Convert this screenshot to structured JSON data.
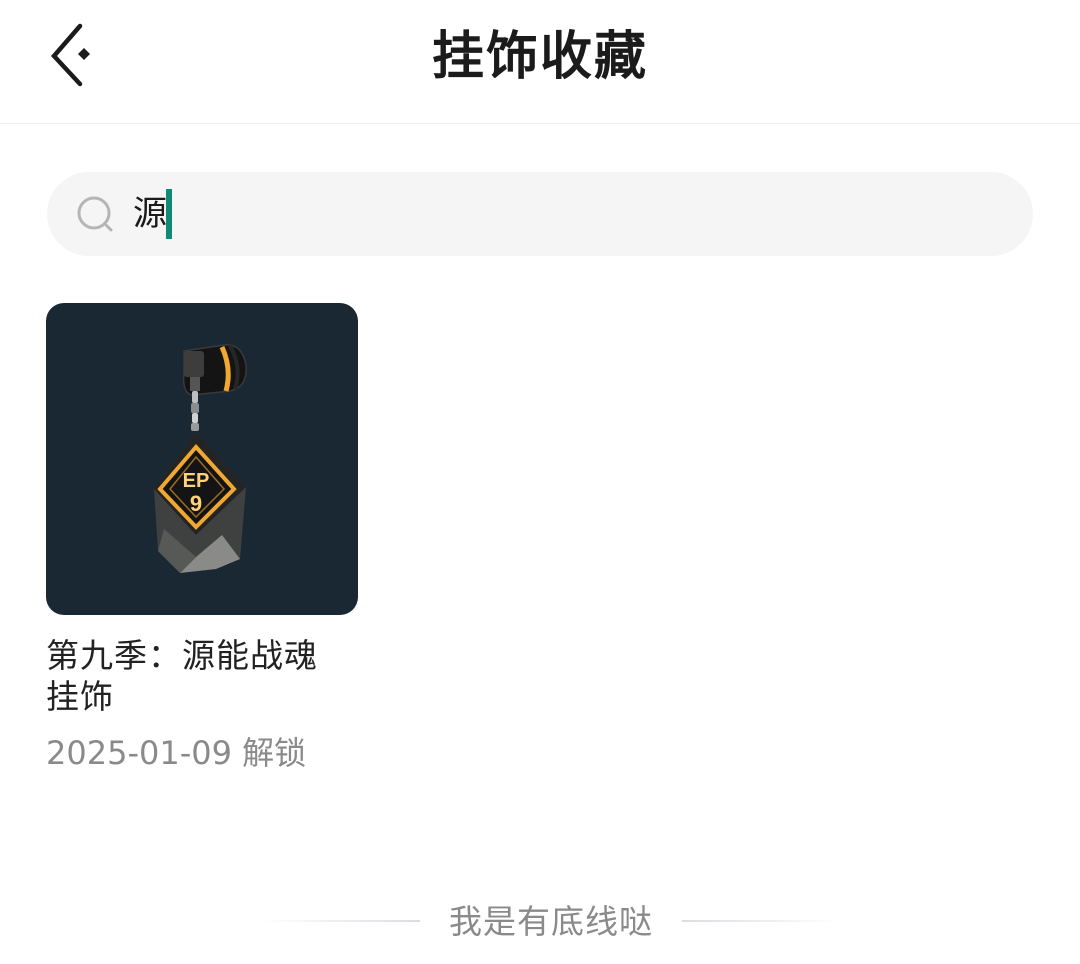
{
  "header": {
    "back_icon": "chevron-left-icon",
    "title": "挂饰收藏"
  },
  "search": {
    "icon": "search-icon",
    "value": "源"
  },
  "items": [
    {
      "name": "第九季：源能战魂挂饰",
      "date": "2025-01-09",
      "status": "解锁",
      "badge_text_line1": "EP",
      "badge_text_line2": "9",
      "colors": {
        "background": "#1a2833",
        "accent": "#f0a832"
      }
    }
  ],
  "footer": {
    "text": "我是有底线哒"
  }
}
